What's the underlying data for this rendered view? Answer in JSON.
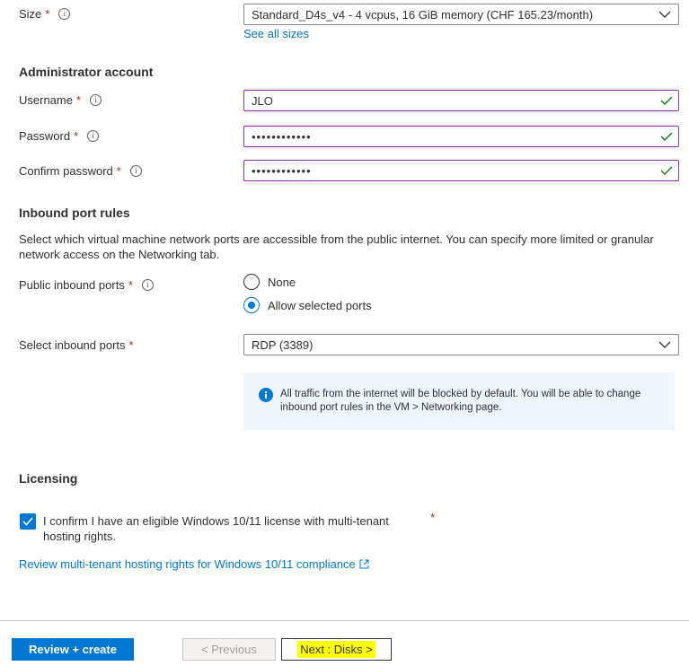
{
  "size": {
    "label": "Size",
    "value": "Standard_D4s_v4 - 4 vcpus, 16 GiB memory (CHF 165.23/month)",
    "see_all_link": "See all sizes"
  },
  "admin": {
    "heading": "Administrator account",
    "username_label": "Username",
    "username_value": "JLO",
    "password_label": "Password",
    "password_value": "••••••••••••",
    "confirm_label": "Confirm password",
    "confirm_value": "••••••••••••"
  },
  "inbound": {
    "heading": "Inbound port rules",
    "description": "Select which virtual machine network ports are accessible from the public internet. You can specify more limited or granular network access on the Networking tab.",
    "public_label": "Public inbound ports",
    "option_none": "None",
    "option_allow": "Allow selected ports",
    "select_label": "Select inbound ports",
    "select_value": "RDP (3389)",
    "info_text": "All traffic from the internet will be blocked by default. You will be able to change inbound port rules in the VM > Networking page."
  },
  "licensing": {
    "heading": "Licensing",
    "confirm_text": "I confirm I have an eligible Windows 10/11 license with multi-tenant hosting rights.",
    "review_link": "Review multi-tenant hosting rights for Windows 10/11 compliance"
  },
  "footer": {
    "review_create": "Review + create",
    "previous": "< Previous",
    "next": "Next : Disks >"
  },
  "colors": {
    "accent": "#0078d4",
    "valid_border": "#8b2ea0",
    "check_green": "#107c10",
    "required": "#a4262c",
    "highlight": "#ffff00"
  }
}
